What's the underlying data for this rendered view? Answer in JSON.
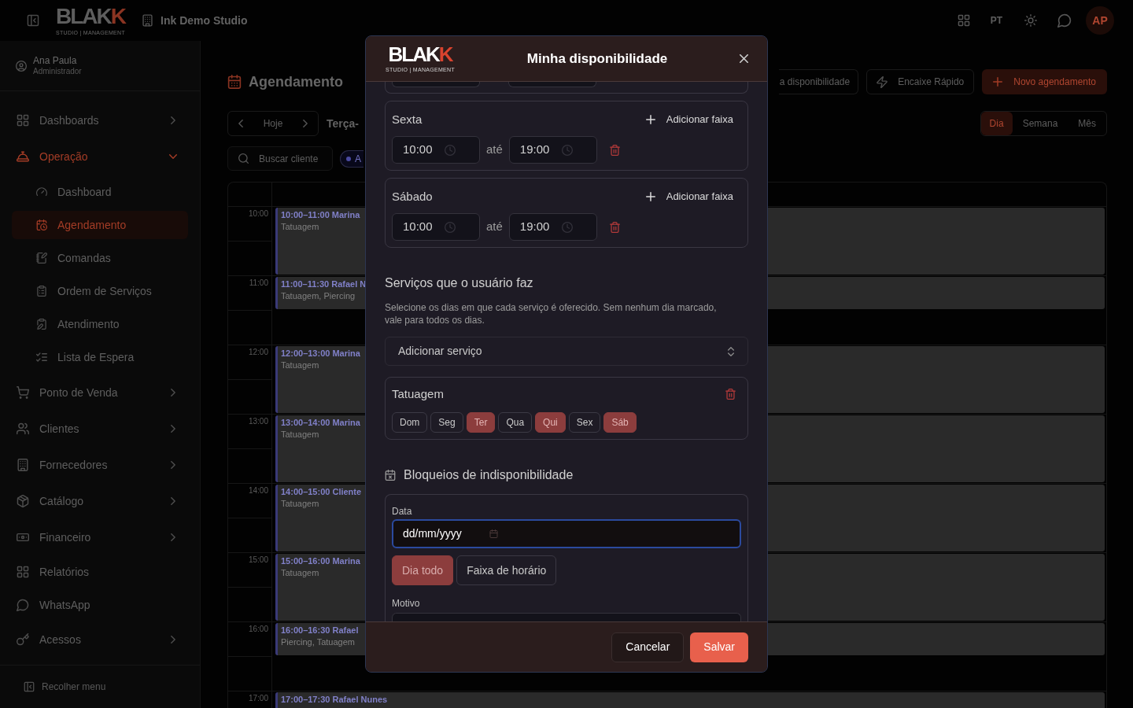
{
  "topbar": {
    "logo": {
      "parts": [
        {
          "text": "BLAK",
          "accent": false
        },
        {
          "text": "K",
          "accent": true
        }
      ],
      "tagline": "STUDIO | MANAGEMENT"
    },
    "studio": "Ink Demo Studio",
    "language": "PT",
    "avatar": "AP"
  },
  "sidebar": {
    "user": {
      "name": "Ana Paula",
      "role": "Administrador"
    },
    "items": [
      {
        "kind": "group",
        "label": "Dashboards",
        "expanded": false,
        "selected": false
      },
      {
        "kind": "group",
        "label": "Operação",
        "expanded": true,
        "selected": false,
        "children": [
          {
            "label": "Dashboard",
            "selected": false
          },
          {
            "label": "Agendamento",
            "selected": true
          },
          {
            "label": "Comandas",
            "selected": false
          },
          {
            "label": "Ordem de Serviços",
            "selected": false
          },
          {
            "label": "Atendimento",
            "selected": false
          },
          {
            "label": "Lista de Espera",
            "selected": false
          }
        ]
      },
      {
        "kind": "group",
        "label": "Ponto de Venda",
        "expanded": false,
        "selected": false
      },
      {
        "kind": "group",
        "label": "Clientes",
        "expanded": false,
        "selected": false
      },
      {
        "kind": "group",
        "label": "Fornecedores",
        "expanded": false,
        "selected": false
      },
      {
        "kind": "group",
        "label": "Catálogo",
        "expanded": false,
        "selected": false
      },
      {
        "kind": "group",
        "label": "Financeiro",
        "expanded": false,
        "selected": false
      },
      {
        "kind": "link",
        "label": "Relatórios",
        "selected": false
      },
      {
        "kind": "link",
        "label": "WhatsApp",
        "selected": false
      },
      {
        "kind": "group",
        "label": "Acessos",
        "expanded": false,
        "selected": false
      }
    ],
    "collapse_button": "Recolher menu"
  },
  "page": {
    "title": "Agendamento",
    "actions": [
      {
        "kind": "outline",
        "label": "a disponibilidade"
      },
      {
        "kind": "quick",
        "label": "Encaixe Rápido"
      },
      {
        "kind": "primary",
        "label": "Novo agendamento"
      }
    ],
    "today_button": "Hoje",
    "date_label": "Terça-",
    "views": [
      {
        "label": "Dia",
        "selected": true
      },
      {
        "label": "Semana",
        "selected": false
      },
      {
        "label": "Mês",
        "selected": false
      }
    ],
    "search": {
      "placeholder": "Buscar cliente"
    },
    "filter_chip": "A"
  },
  "calendar": {
    "rows": [
      {
        "time": "10:00",
        "event": {
          "kind": "hour",
          "title": "10:00–11:00 Marina",
          "services": "Tatuagem"
        }
      },
      {
        "time": "11:00",
        "event": {
          "kind": "half",
          "title": "11:00–11:30 Rafael N",
          "services": "Tatuagem, Piercing"
        }
      },
      {
        "time": "12:00",
        "event": {
          "kind": "hour",
          "title": "12:00–13:00 Marina",
          "services": "Tatuagem"
        }
      },
      {
        "time": "13:00",
        "event": {
          "kind": "hour",
          "title": "13:00–14:00 Marina",
          "services": "Tatuagem"
        }
      },
      {
        "time": "14:00",
        "event": {
          "kind": "hour",
          "title": "14:00–15:00 Cliente",
          "services": "Tatuagem"
        }
      },
      {
        "time": "15:00",
        "event": {
          "kind": "hour",
          "title": "15:00–16:00 Marina",
          "services": "Tatuagem"
        }
      },
      {
        "time": "16:00",
        "event": {
          "kind": "half",
          "title": "16:00–16:30 Rafael",
          "services": "Piercing, Tatuagem"
        }
      },
      {
        "time": "17:00",
        "event": {
          "kind": "half",
          "title": "17:00–17:30 Rafael Nunes"
        }
      }
    ]
  },
  "modal": {
    "logo": {
      "parts": [
        {
          "text": "BLAK",
          "accent": false
        },
        {
          "text": "K",
          "accent": true
        }
      ],
      "tagline": "STUDIO | MANAGEMENT"
    },
    "title": "Minha disponibilidade",
    "availability": [
      {
        "kind": "clipped"
      },
      {
        "kind": "day",
        "day": "Sexta",
        "add_label": "Adicionar faixa",
        "ranges": [
          {
            "start": "10:00",
            "separator": "até",
            "end": "19:00"
          }
        ]
      },
      {
        "kind": "day",
        "day": "Sábado",
        "add_label": "Adicionar faixa",
        "ranges": [
          {
            "start": "10:00",
            "separator": "até",
            "end": "19:00"
          }
        ]
      }
    ],
    "services": {
      "title": "Serviços que o usuário faz",
      "description": "Selecione os dias em que cada serviço é oferecido. Sem nenhum dia marcado, vale para todos os dias.",
      "select": {
        "placeholder": "Adicionar serviço"
      },
      "items": [
        {
          "name": "Tatuagem",
          "days": [
            {
              "label": "Dom",
              "selected": false
            },
            {
              "label": "Seg",
              "selected": false
            },
            {
              "label": "Ter",
              "selected": true
            },
            {
              "label": "Qua",
              "selected": false
            },
            {
              "label": "Qui",
              "selected": true
            },
            {
              "label": "Sex",
              "selected": false
            },
            {
              "label": "Sáb",
              "selected": true
            }
          ]
        }
      ]
    },
    "blocks": {
      "title": "Bloqueios de indisponibilidade",
      "date": {
        "label": "Data",
        "placeholder": "dd/mm/yyyy",
        "focused": true
      },
      "modes": [
        {
          "label": "Dia todo",
          "selected": true
        },
        {
          "label": "Faixa de horário",
          "selected": false
        }
      ],
      "reason": {
        "label": "Motivo"
      }
    },
    "footer": {
      "buttons": [
        {
          "kind": "secondary",
          "label": "Cancelar"
        },
        {
          "kind": "primary",
          "label": "Salvar"
        }
      ]
    }
  }
}
